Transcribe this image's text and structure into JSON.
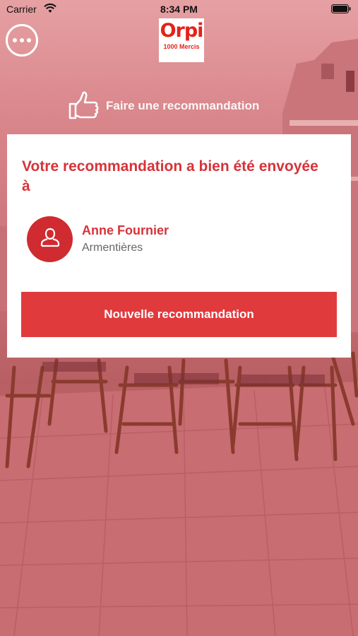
{
  "status_bar": {
    "carrier": "Carrier",
    "time": "8:34 PM"
  },
  "header": {
    "menu_icon": "more-horizontal-icon",
    "logo": {
      "brand": "Orpi",
      "tagline": "1000 Mercis"
    },
    "recommend_link": {
      "icon": "thumbs-up-icon",
      "label": "Faire une recommandation"
    }
  },
  "confirmation": {
    "title": "Votre recommandation a bien été envoyée à",
    "contact": {
      "avatar_icon": "person-icon",
      "name": "Anne Fournier",
      "city": "Armentières"
    },
    "new_button_label": "Nouvelle recommandation"
  },
  "colors": {
    "accent": "#e03a3d",
    "title_red": "#d63339",
    "background_tint": "#d4747a"
  }
}
